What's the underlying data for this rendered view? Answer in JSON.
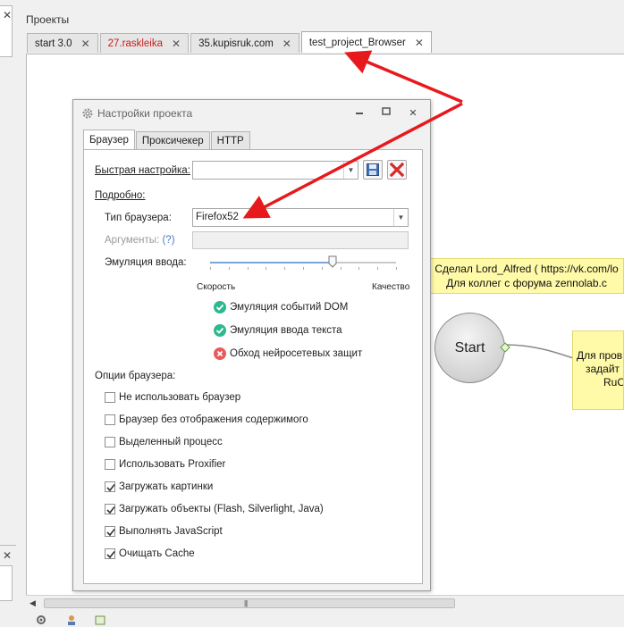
{
  "panel": {
    "title": "Проекты",
    "tabs": [
      {
        "label": "start 3.0",
        "close": "✕"
      },
      {
        "label": "27.raskleika",
        "close": "✕"
      },
      {
        "label": "35.kupisruk.com",
        "close": "✕"
      },
      {
        "label": "test_project_Browser",
        "close": "✕"
      }
    ],
    "active_tab": 3
  },
  "canvas": {
    "note_top": {
      "line1": "Сделал Lord_Alfred ( https://vk.com/lo",
      "line2": "Для коллег с форума zennolab.c"
    },
    "note_right": {
      "line1": "Для пров",
      "line2": "задайт",
      "line3": "RuCa"
    },
    "start_node": "Start"
  },
  "dialog": {
    "title": "Настройки проекта",
    "buttons": {
      "minimize": "▭",
      "maximize": "▢",
      "close": "✕"
    },
    "tabs": [
      "Браузер",
      "Проксичекер",
      "HTTP"
    ],
    "quick_setup": {
      "label": "Быстрая настройка:",
      "value": ""
    },
    "details_label": "Подробно:",
    "browser_type": {
      "label": "Тип браузера:",
      "value": "Firefox52"
    },
    "arguments": {
      "label": "Аргументы:",
      "help": "(?)",
      "value": ""
    },
    "input_emulation": {
      "label": "Эмуляция ввода:",
      "left": "Скорость",
      "right": "Качество",
      "level_percent": 66
    },
    "status": [
      {
        "label": "Эмуляция событий DOM",
        "state": "on"
      },
      {
        "label": "Эмуляция ввода текста",
        "state": "on"
      },
      {
        "label": "Обход нейросетевых защит",
        "state": "off"
      }
    ],
    "options_label": "Опции браузера:",
    "options": [
      {
        "label": "Не использовать браузер",
        "checked": false
      },
      {
        "label": "Браузер без отображения содержимого",
        "checked": false
      },
      {
        "label": "Выделенный процесс",
        "checked": false
      },
      {
        "label": "Использовать Proxifier",
        "checked": false
      },
      {
        "label": "Загружать картинки",
        "checked": true
      },
      {
        "label": "Загружать объекты (Flash, Silverlight, Java)",
        "checked": true
      },
      {
        "label": "Выполнять JavaScript",
        "checked": true
      },
      {
        "label": "Очищать Cache",
        "checked": true
      }
    ]
  },
  "colors": {
    "annotation_arrow": "#e8191c",
    "note_bg": "#fffaa8",
    "ok": "#2fb88f",
    "fail": "#e85b5b"
  }
}
